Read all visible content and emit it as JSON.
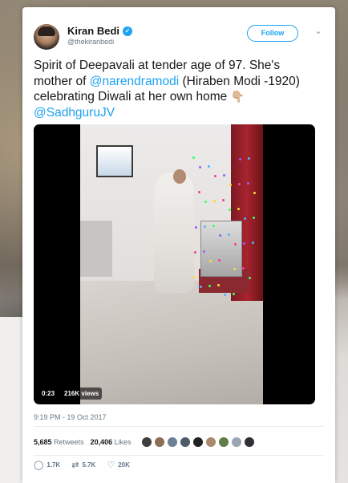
{
  "author": {
    "name": "Kiran Bedi",
    "handle": "@thekiranbedi",
    "verified_glyph": "✓"
  },
  "follow_label": "Follow",
  "chevron_glyph": "⌄",
  "tweet": {
    "text_1": "Spirit of Deepavali at tender age of 97. She's mother of ",
    "mention_1": "@narendramodi",
    "text_2": " (Hiraben Modi -1920) celebrating Diwali at her own home ",
    "emoji": "👇🏼",
    "mention_2": "@SadhguruJV"
  },
  "media": {
    "duration": "0:23",
    "views": "216K views"
  },
  "timestamp": "9:19 PM - 19 Oct 2017",
  "stats": {
    "retweets_count": "5,685",
    "retweets_label": "Retweets",
    "likes_count": "20,406",
    "likes_label": "Likes"
  },
  "actions": {
    "reply_icon": "◯",
    "reply_count": "1.7K",
    "retweet_icon": "⇄",
    "retweet_count": "5.7K",
    "like_icon": "♡",
    "like_count": "20K"
  },
  "colors": {
    "accent": "#1da1f2",
    "text": "#14171a",
    "muted": "#657786"
  }
}
